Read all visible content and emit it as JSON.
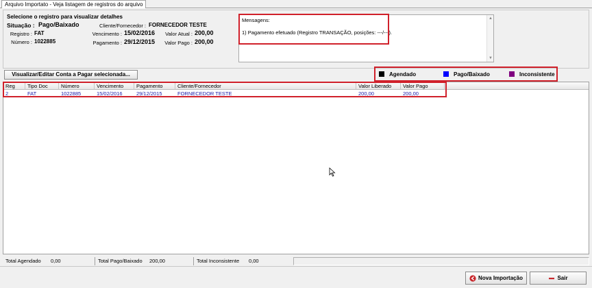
{
  "tab": {
    "label": "Arquivo Importato - Veja listagem de registros do arquivo"
  },
  "details": {
    "hint": "Selecione o registro para visualizar detalhes",
    "situacao_label": "Situação :",
    "situacao_value": "Pago/Baixado",
    "registro_label": "Registro :",
    "registro_value": "FAT",
    "numero_label": "Número :",
    "numero_value": "1022885",
    "cliente_label": "Cliente/Fornecedor :",
    "cliente_value": "FORNECEDOR TESTE",
    "vencimento_label": "Vencimento :",
    "vencimento_value": "15/02/2016",
    "valor_atual_label": "Valor Atual :",
    "valor_atual_value": "200,00",
    "pagamento_label": "Pagamento :",
    "pagamento_value": "29/12/2015",
    "valor_pago_label": "Valor Pago :",
    "valor_pago_value": "200,00"
  },
  "messages": {
    "title": "Mensagens:",
    "lines": [
      "1) Pagamento efetuado (Registro TRANSAÇÃO, posições: ---/---)."
    ]
  },
  "toolbar": {
    "edit_button": "Visualizar/Editar Conta a Pagar selecionada..."
  },
  "legend": {
    "items": [
      {
        "label": "Agendado",
        "color": "#000000"
      },
      {
        "label": "Pago/Baixado",
        "color": "#0000ff"
      },
      {
        "label": "Inconsistente",
        "color": "#800080"
      }
    ]
  },
  "grid": {
    "columns": [
      "Reg",
      "Tipo Doc",
      "Número",
      "Vencimento",
      "Pagamento",
      "Cliente/Fornecedor",
      "Valor Liberado",
      "Valor Pago"
    ],
    "rows": [
      [
        "2",
        "FAT",
        "1022885",
        "15/02/2016",
        "29/12/2015",
        "FORNECEDOR TESTE",
        "200,00",
        "200,00"
      ]
    ],
    "row_color": "#1a1aa8"
  },
  "totals": {
    "agendado_label": "Total Agendado",
    "agendado_value": "0,00",
    "pago_label": "Total Pago/Baixado",
    "pago_value": "200,00",
    "inconsistente_label": "Total Inconsistente",
    "inconsistente_value": "0,00"
  },
  "actions": {
    "nova_importacao": "Nova Importação",
    "sair": "Sair"
  },
  "icons": {
    "nova_importacao": "back-arrow-icon",
    "sair": "minus-icon"
  },
  "colors": {
    "highlight": "#d0202a"
  }
}
